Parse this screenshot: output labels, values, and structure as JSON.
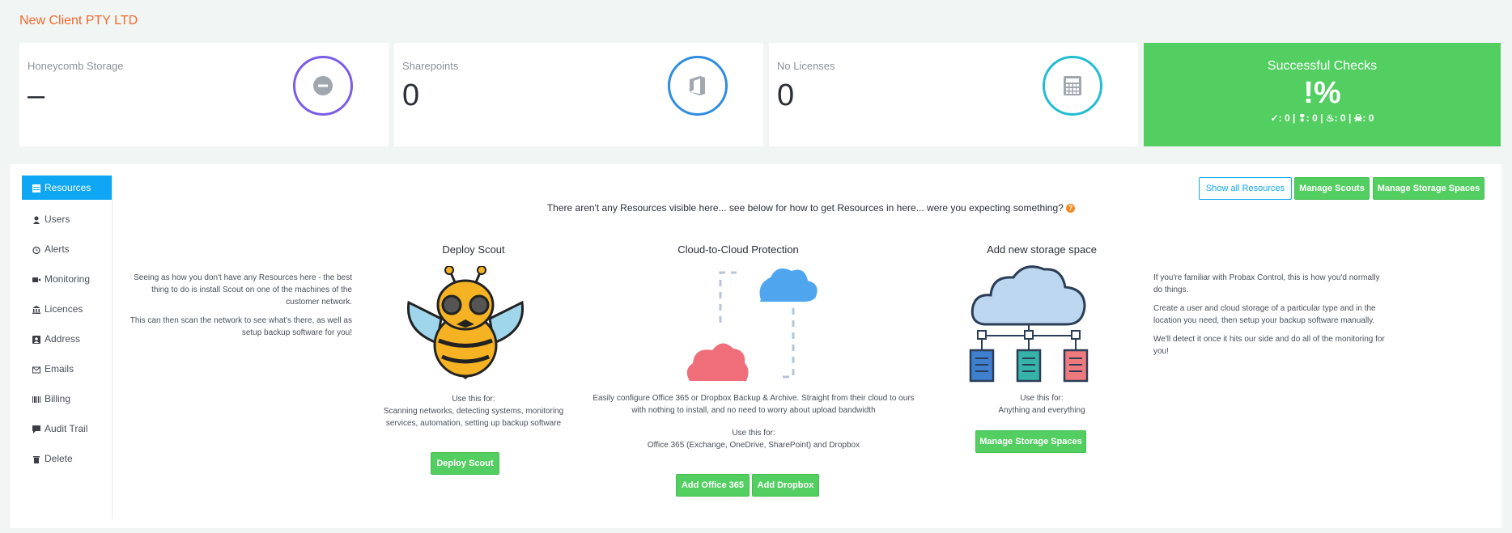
{
  "header": {
    "company": "New Client PTY LTD"
  },
  "stats": [
    {
      "label": "Honeycomb Storage",
      "value": "–",
      "icon": "minus-circle-icon",
      "color": "#7c5ce6"
    },
    {
      "label": "Sharepoints",
      "value": "0",
      "icon": "office-icon",
      "color": "#2f8ddf"
    },
    {
      "label": "No Licenses",
      "value": "0",
      "icon": "calculator-icon",
      "color": "#22bcd3"
    }
  ],
  "success": {
    "title": "Successful Checks",
    "value": "!%",
    "counts": [
      {
        "icon": "check-icon",
        "glyph": "✓",
        "value": "0"
      },
      {
        "icon": "bolt-icon",
        "glyph": "❢",
        "value": "0"
      },
      {
        "icon": "fire-icon",
        "glyph": "♨",
        "value": "0"
      },
      {
        "icon": "skull-icon",
        "glyph": "☠",
        "value": "0"
      }
    ],
    "color": "#53cf62"
  },
  "sidebar": {
    "items": [
      {
        "label": "Resources",
        "icon": "list-icon",
        "active": true
      },
      {
        "label": "Users",
        "icon": "user-icon"
      },
      {
        "label": "Alerts",
        "icon": "clock-icon"
      },
      {
        "label": "Monitoring",
        "icon": "video-icon"
      },
      {
        "label": "Licences",
        "icon": "bank-icon"
      },
      {
        "label": "Address",
        "icon": "contact-icon"
      },
      {
        "label": "Emails",
        "icon": "envelope-icon"
      },
      {
        "label": "Billing",
        "icon": "barcode-icon"
      },
      {
        "label": "Audit Trail",
        "icon": "comment-icon"
      },
      {
        "label": "Delete",
        "icon": "trash-icon"
      }
    ]
  },
  "toolbar": {
    "show_all": "Show all Resources",
    "manage_scouts": "Manage Scouts",
    "manage_storage": "Manage Storage Spaces"
  },
  "notice": "There aren't any Resources visible here... see below for how to get Resources in here... were you expecting something?",
  "left_text": {
    "p1": "Seeing as how you don't have any Resources here - the best thing to do is install Scout on one of the machines of the customer network.",
    "p2": "This can then scan the network to see what's there, as well as setup backup software for you!"
  },
  "scout": {
    "title": "Deploy Scout",
    "use_label": "Use this for:",
    "use_text": "Scanning networks, detecting systems, monitoring services, automation, setting up backup software",
    "button": "Deploy Scout"
  },
  "cloud": {
    "title": "Cloud-to-Cloud Protection",
    "desc": "Easily configure Office 365 or Dropbox Backup & Archive. Straight from their cloud to ours with nothing to install, and no need to worry about upload bandwidth",
    "use_label": "Use this for:",
    "use_text": "Office 365 (Exchange, OneDrive, SharePoint) and Dropbox",
    "button_o365": "Add Office 365",
    "button_dropbox": "Add Dropbox"
  },
  "storage": {
    "title": "Add new storage space",
    "use_label": "Use this for:",
    "use_text": "Anything and everything",
    "button": "Manage Storage Spaces"
  },
  "right_text": {
    "p1": "If you're familiar with Probax Control, this is how you'd normally do things.",
    "p2": "Create a user and cloud storage of a particular type and in the location you need, then setup your backup software manually.",
    "p3": "We'll detect it once it hits our side and do all of the monitoring for you!"
  }
}
